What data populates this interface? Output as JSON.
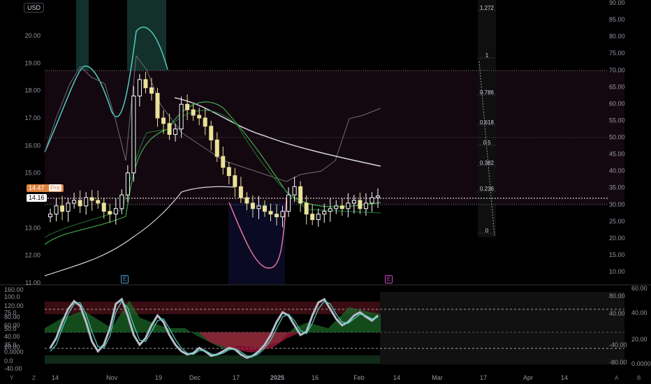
{
  "currency_button": "USD",
  "price_badges": {
    "pre_value": "14.47",
    "pre_label": "Pre",
    "last_value": "14.16"
  },
  "earnings_markers": [
    "E",
    "E"
  ],
  "corner_labels": {
    "bottom_left_1": "Y",
    "bottom_left_2": "Z",
    "bottom_right_1": "A",
    "bottom_right_2": "B"
  },
  "colors": {
    "up": "#ffffff",
    "down": "#e8e29a",
    "teal": "#4dd0c0",
    "pink": "#e8739b",
    "green": "#3fa74a",
    "grey": "#d1d4dc",
    "fib": "#787b86"
  },
  "chart_data": [
    {
      "type": "candlestick",
      "price_axis_left": {
        "ticks": [
          "20.00",
          "19.00",
          "18.00",
          "17.00",
          "16.00",
          "15.00",
          "13.00",
          "12.00",
          "11.00"
        ],
        "ylim": [
          11.0,
          20.8
        ]
      },
      "osc_axis_right": {
        "ticks": [
          "90.00",
          "85.00",
          "80.00",
          "75.00",
          "70.00",
          "65.00",
          "60.00",
          "55.00",
          "50.00",
          "45.00",
          "40.00",
          "35.00",
          "30.00",
          "25.00",
          "20.00",
          "15.00",
          "10.00"
        ]
      },
      "fib_levels": [
        {
          "label": "1.272"
        },
        {
          "label": "1"
        },
        {
          "label": "0.786"
        },
        {
          "label": "0.618"
        },
        {
          "label": "0.5"
        },
        {
          "label": "0.382"
        },
        {
          "label": "0.236"
        },
        {
          "label": "0"
        }
      ],
      "x_ticks": [
        "14",
        "Nov",
        "19",
        "Dec",
        "17",
        "2025",
        "16",
        "Feb",
        "14",
        "Mar",
        "17",
        "Apr",
        "14"
      ],
      "closes": [
        13.5,
        13.8,
        13.6,
        13.9,
        14.0,
        13.8,
        14.1,
        14.0,
        13.9,
        13.6,
        13.5,
        13.7,
        14.2,
        15.0,
        17.8,
        18.4,
        18.1,
        17.9,
        17.0,
        16.8,
        16.4,
        16.6,
        17.5,
        17.3,
        17.1,
        17.0,
        16.7,
        16.2,
        15.6,
        15.2,
        14.9,
        14.5,
        14.1,
        13.9,
        13.7,
        13.8,
        13.6,
        13.5,
        13.4,
        13.6,
        14.2,
        14.5,
        13.9,
        13.5,
        13.3,
        13.5,
        13.6,
        13.7,
        13.8,
        13.7,
        13.9,
        14.0,
        13.7,
        13.9,
        14.1,
        14.16
      ]
    },
    {
      "type": "line",
      "title": "",
      "left_axis": {
        "ticks": [
          "160.00",
          "120.00",
          "100.0",
          "80.00",
          "75.0",
          "60.00",
          "50.0",
          "40.00",
          "25.0",
          "20.00",
          "0.0000",
          "0.0",
          "-40.00"
        ]
      },
      "right_axis": {
        "ticks": [
          "60.00",
          "80.00",
          "40.00",
          "40.00",
          "20.00",
          "-40.00",
          "0.0000",
          "-80.00"
        ]
      },
      "series": [
        {
          "values": [
            20,
            35,
            60,
            80,
            92,
            85,
            60,
            30,
            15,
            25,
            50,
            88,
            95,
            70,
            40,
            25,
            35,
            55,
            70,
            60,
            40,
            25,
            15,
            10,
            12,
            20,
            15,
            8,
            10,
            15,
            20,
            18,
            10,
            5,
            8,
            15,
            25,
            40,
            60,
            75,
            70,
            55,
            40,
            45,
            70,
            90,
            95,
            80,
            65,
            55,
            60,
            70,
            75,
            68,
            62,
            70
          ]
        },
        {
          "values": [
            15,
            25,
            50,
            72,
            88,
            90,
            72,
            45,
            22,
            20,
            38,
            75,
            92,
            82,
            55,
            32,
            30,
            45,
            62,
            65,
            50,
            33,
            20,
            12,
            10,
            16,
            16,
            11,
            9,
            12,
            17,
            19,
            14,
            8,
            7,
            11,
            20,
            32,
            50,
            68,
            72,
            62,
            47,
            42,
            58,
            80,
            92,
            88,
            72,
            60,
            58,
            65,
            72,
            70,
            65,
            67
          ]
        }
      ]
    }
  ]
}
